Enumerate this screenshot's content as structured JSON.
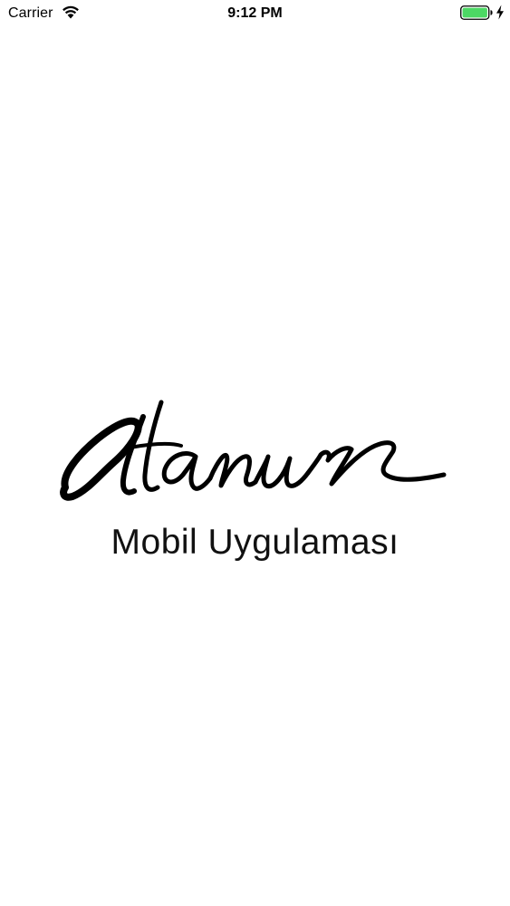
{
  "status_bar": {
    "carrier": "Carrier",
    "time": "9:12 PM",
    "icons": [
      "wifi-icon",
      "battery-icon",
      "charging-icon"
    ],
    "battery_level": 1.0,
    "battery_color": "#4cd964"
  },
  "splash": {
    "logo_wordmark": "Atanur",
    "tagline": "Mobil Uygulaması"
  },
  "colors": {
    "background": "#ffffff",
    "text": "#000000"
  }
}
